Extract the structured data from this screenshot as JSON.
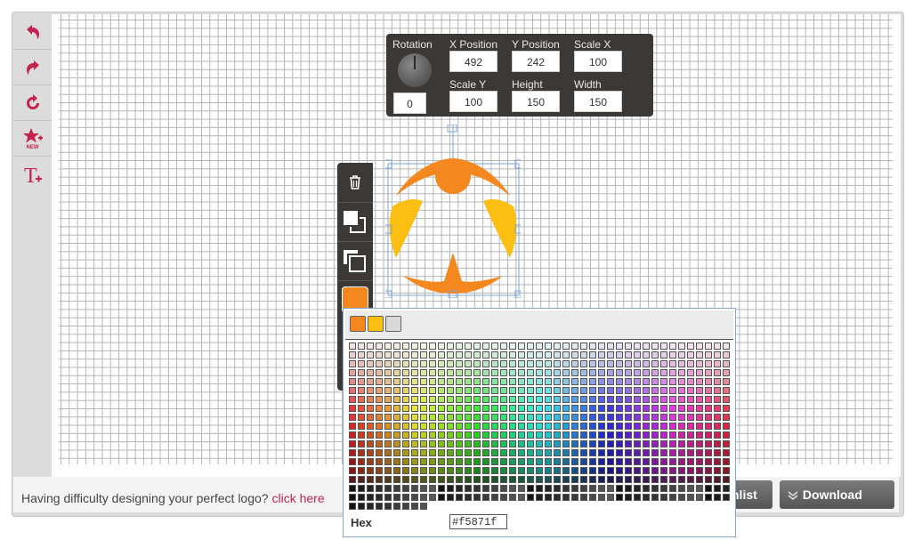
{
  "toolbar": {
    "tools": [
      {
        "name": "undo-icon"
      },
      {
        "name": "redo-icon"
      },
      {
        "name": "refresh-icon"
      },
      {
        "name": "new-shape-icon",
        "badge": "NEW"
      },
      {
        "name": "add-text-icon"
      }
    ]
  },
  "properties": {
    "rotation_label": "Rotation",
    "rotation_value": "0",
    "x_label": "X Position",
    "x_value": "492",
    "y_label": "Y Position",
    "y_value": "242",
    "scale_x_label": "Scale X",
    "scale_x_value": "100",
    "scale_y_label": "Scale Y",
    "scale_y_value": "100",
    "height_label": "Height",
    "height_value": "150",
    "width_label": "Width",
    "width_value": "150"
  },
  "side_tools": [
    "trash-icon",
    "copy-icon",
    "layer-icon",
    "fill-color-swatch"
  ],
  "logo_colors": {
    "primary": "#f5871f",
    "secondary": "#fbbf14"
  },
  "picker": {
    "current_swatches": [
      "#f5871f",
      "#fbbf14",
      "#d9d9d9"
    ],
    "hex_label": "Hex",
    "hex_value": "#f5871f"
  },
  "footer": {
    "help_text": "Having difficulty designing your perfect logo?",
    "help_link": "click here",
    "wishlist_label": "hlist",
    "download_label": "Download"
  },
  "colors": {
    "accent": "#c4234f",
    "panel": "#3b3835"
  }
}
